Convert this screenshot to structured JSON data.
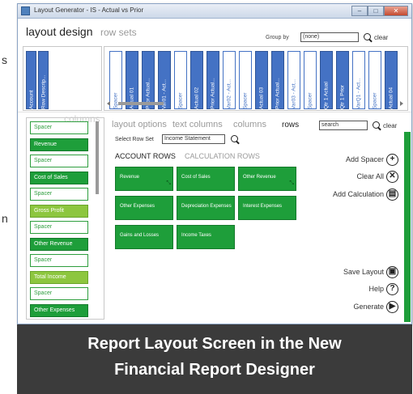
{
  "outside_chars": [
    "s",
    "n"
  ],
  "window": {
    "title": "Layout Generator - IS - Actual vs Prior",
    "controls": [
      "–",
      "□",
      "✕"
    ]
  },
  "mode_tabs": {
    "active": "layout design",
    "inactive": "row sets"
  },
  "group_by": {
    "label": "Group by",
    "value": "(none)",
    "clear": "clear"
  },
  "column_area": {
    "fixed_columns": [
      "Account",
      "Row Descrip..."
    ],
    "watermark": "columns",
    "strips": [
      {
        "label": "Spacer",
        "style": "white"
      },
      {
        "label": "Actual 01",
        "style": "blue"
      },
      {
        "label": "Prior Actual...",
        "style": "blue"
      },
      {
        "label": "Var01 - Act...",
        "style": "blue"
      },
      {
        "label": "Spacer",
        "style": "white"
      },
      {
        "label": "Actual 02",
        "style": "blue"
      },
      {
        "label": "Prior Actual...",
        "style": "blue"
      },
      {
        "label": "Var02 - Act...",
        "style": "white"
      },
      {
        "label": "Spacer",
        "style": "white"
      },
      {
        "label": "Actual 03",
        "style": "blue"
      },
      {
        "label": "Prior Actual...",
        "style": "blue"
      },
      {
        "label": "Var03 - Act...",
        "style": "white"
      },
      {
        "label": "Spacer",
        "style": "white"
      },
      {
        "label": "Qtr 1 Actual",
        "style": "blue"
      },
      {
        "label": "Qtr 1 Prior",
        "style": "blue"
      },
      {
        "label": "VarQ1 - Act...",
        "style": "white"
      },
      {
        "label": "Spacer",
        "style": "white"
      },
      {
        "label": "Actual 04",
        "style": "blue"
      }
    ]
  },
  "row_list": [
    {
      "label": "Spacer",
      "style": "spacer"
    },
    {
      "label": "Revenue",
      "style": "green"
    },
    {
      "label": "Spacer",
      "style": "spacer"
    },
    {
      "label": "Cost of Sales",
      "style": "green"
    },
    {
      "label": "Spacer",
      "style": "spacer"
    },
    {
      "label": "Gross Profit",
      "style": "light"
    },
    {
      "label": "Spacer",
      "style": "spacer"
    },
    {
      "label": "Other Revenue",
      "style": "green"
    },
    {
      "label": "Spacer",
      "style": "spacer"
    },
    {
      "label": "Total Income",
      "style": "light"
    },
    {
      "label": "Spacer",
      "style": "spacer"
    },
    {
      "label": "Other Expenses",
      "style": "green"
    }
  ],
  "options_tabs": [
    {
      "label": "layout options",
      "active": false
    },
    {
      "label": "text columns",
      "active": false
    },
    {
      "label": "columns",
      "active": false
    },
    {
      "label": "rows",
      "active": true
    }
  ],
  "search": {
    "value": "search",
    "clear": "clear"
  },
  "row_set": {
    "label": "Select Row Set",
    "value": "Income Statement"
  },
  "sub_tabs": {
    "active": "ACCOUNT ROWS",
    "inactive": "CALCULATION ROWS"
  },
  "account_tiles": [
    "Revenue",
    "Cost of Sales",
    "Other Revenue",
    "Other Expenses",
    "Depreciation Expenses",
    "Interest Expenses",
    "Gains and Losses",
    "Income Taxes"
  ],
  "actions_top": [
    {
      "label": "Add Spacer",
      "icon": "+"
    },
    {
      "label": "Clear All",
      "icon": "✕"
    },
    {
      "label": "Add Calculation",
      "icon": "▤"
    }
  ],
  "actions_bottom": [
    {
      "label": "Save Layout",
      "icon": "▣"
    },
    {
      "label": "Help",
      "icon": "?"
    },
    {
      "label": "Generate",
      "icon": "▶"
    }
  ],
  "caption": {
    "line1": "Report Layout Screen in the New",
    "line2": "Financial Report Designer"
  }
}
